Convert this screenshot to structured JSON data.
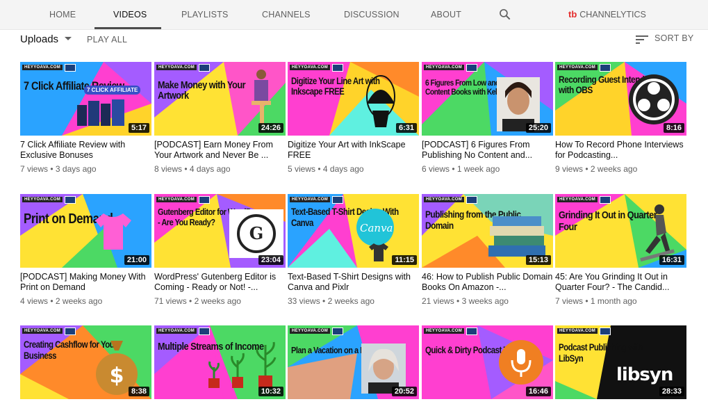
{
  "tabs": [
    {
      "label": "HOME"
    },
    {
      "label": "VIDEOS"
    },
    {
      "label": "PLAYLISTS"
    },
    {
      "label": "CHANNELS"
    },
    {
      "label": "DISCUSSION"
    },
    {
      "label": "ABOUT"
    }
  ],
  "channelytics": {
    "logo": "tb",
    "label": "CHANNELYTICS"
  },
  "toolbar": {
    "uploads_label": "Uploads",
    "play_all": "PLAY ALL",
    "sort_by": "SORT BY"
  },
  "brand_label": "HEYYOAVA.COM",
  "colors": {
    "accent": "#e42a2a",
    "text": "#0d0d0d",
    "muted": "#606060"
  },
  "videos": [
    {
      "thumb_text": "7 Click Affiliate Review",
      "title": "7 Click Affiliate Review with Exclusive Bonuses",
      "views": "7 views",
      "age": "3 days ago",
      "duration": "5:17",
      "art_label": "7 CLICK AFFILIATE"
    },
    {
      "thumb_text": "Make Money with Your Artwork",
      "title": "[PODCAST] Earn Money From Your Artwork and Never Be ...",
      "views": "8 views",
      "age": "4 days ago",
      "duration": "24:26"
    },
    {
      "thumb_text": "Digitize Your Line Art with Inkscape FREE",
      "title": "Digitize Your Art with InkScape FREE",
      "views": "5 views",
      "age": "4 days ago",
      "duration": "6:31"
    },
    {
      "thumb_text": "6 Figures From Low and No Content Books with Kelli Roberts",
      "title": "[PODCAST] 6 Figures From Publishing No Content and...",
      "views": "6 views",
      "age": "1 week ago",
      "duration": "25:20"
    },
    {
      "thumb_text": "Recording Guest Interviews with OBS",
      "title": "How To Record Phone Interviews for Podcasting...",
      "views": "9 views",
      "age": "2 weeks ago",
      "duration": "8:16"
    },
    {
      "thumb_text": "Print on Demand",
      "title": "[PODCAST] Making Money With Print on Demand",
      "views": "4 views",
      "age": "2 weeks ago",
      "duration": "21:00"
    },
    {
      "thumb_text": "Gutenberg Editor for WordPress - Are You Ready?",
      "title": "WordPress' Gutenberg Editor is Coming - Ready or Not! -...",
      "views": "71 views",
      "age": "2 weeks ago",
      "duration": "23:04"
    },
    {
      "thumb_text": "Text-Based T-Shirt Design With Canva",
      "title": "Text-Based T-Shirt Designs with Canva and Pixlr",
      "views": "33 views",
      "age": "2 weeks ago",
      "duration": "11:15",
      "art_label": "Canva"
    },
    {
      "thumb_text": "Publishing from the Public Domain",
      "title": "46: How to Publish Public Domain Books On Amazon -...",
      "views": "21 views",
      "age": "3 weeks ago",
      "duration": "15:13"
    },
    {
      "thumb_text": "Grinding It Out in Quarter Four",
      "title": "45: Are You Grinding It Out in Quarter Four? - The Candid...",
      "views": "7 views",
      "age": "1 month ago",
      "duration": "16:31"
    },
    {
      "thumb_text": "Creating Cashflow for Your Business",
      "title": "",
      "views": "",
      "age": "",
      "duration": "8:38"
    },
    {
      "thumb_text": "Multiple Streams of Income",
      "title": "",
      "views": "",
      "age": "",
      "duration": "10:32"
    },
    {
      "thumb_text": "Plan a Vacation on a Budget",
      "title": "",
      "views": "",
      "age": "",
      "duration": "20:52"
    },
    {
      "thumb_text": "Quick & Dirty Podcast Tutorial",
      "title": "",
      "views": "",
      "age": "",
      "duration": "16:46"
    },
    {
      "thumb_text": "Podcast Publishing with LibSyn",
      "title": "",
      "views": "",
      "age": "",
      "duration": "28:33",
      "art_label": "libsyn"
    }
  ]
}
